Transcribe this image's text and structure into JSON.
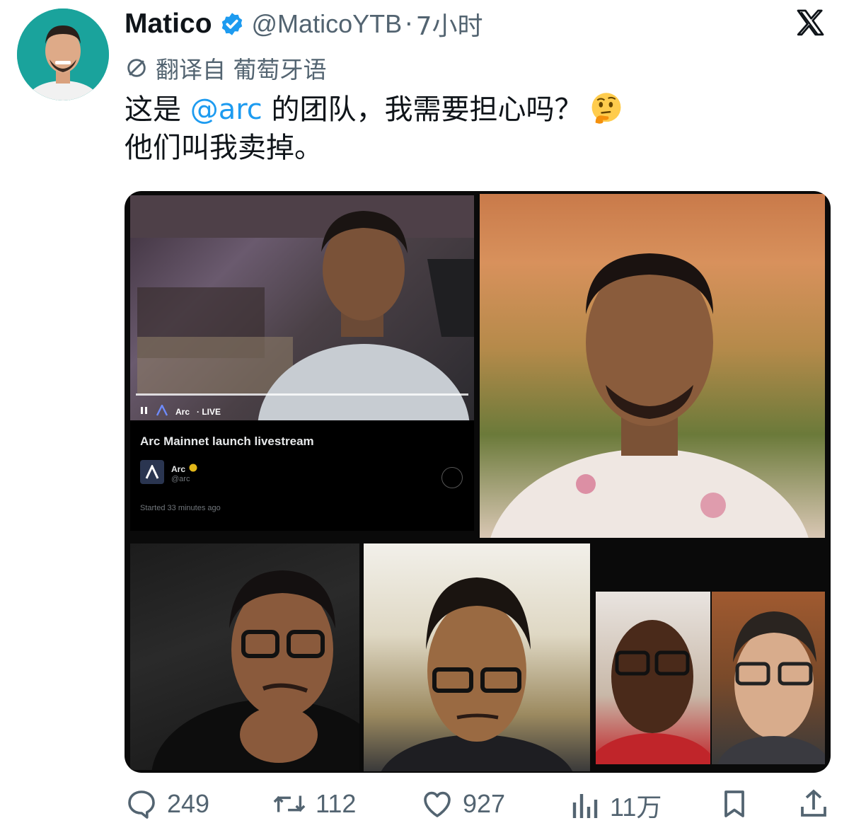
{
  "author": {
    "name": "Matico",
    "handle": "@MaticoYTB",
    "separator": "·",
    "time": "7小时"
  },
  "translation": {
    "label": "翻译自 葡萄牙语"
  },
  "tweet": {
    "text_before": "这是 ",
    "mention": "@arc",
    "text_after": " 的团队，我需要担心吗？",
    "line2": "他们叫我卖掉。"
  },
  "media": {
    "live_tile": {
      "brand": "Arc",
      "live_label": "· LIVE",
      "title": "Arc Mainnet launch livestream",
      "account_name": "Arc",
      "account_handle": "@arc",
      "started": "Started 33 minutes ago"
    }
  },
  "actions": {
    "replies": "249",
    "reposts": "112",
    "likes": "927",
    "views": "11万"
  },
  "colors": {
    "link": "#1d9bf0",
    "muted": "#536471",
    "verified": "#1d9bf0",
    "avatar_bg": "#1aa39c"
  }
}
